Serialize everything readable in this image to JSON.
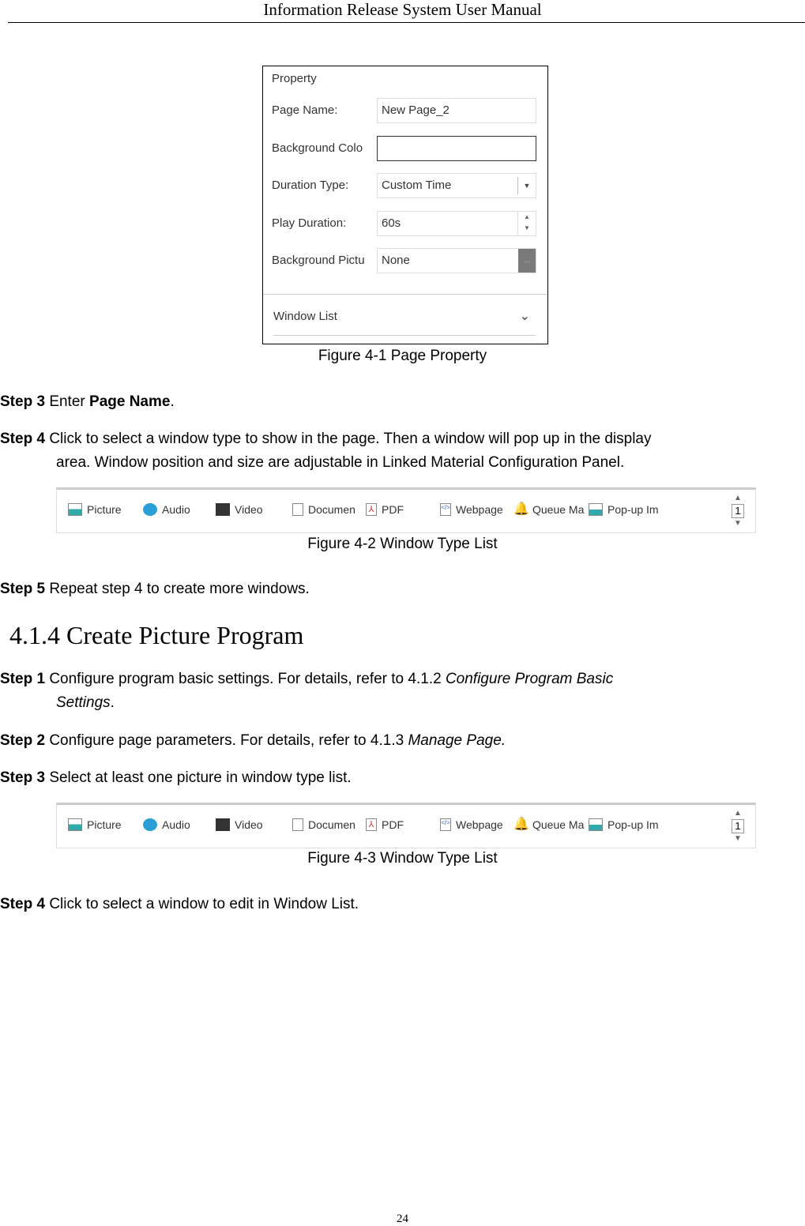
{
  "header": {
    "title": "Information Release System User Manual"
  },
  "figure1": {
    "panel_title": "Property",
    "fields": [
      {
        "label": "Page Name:",
        "value": "New Page_2"
      },
      {
        "label": "Background Colo",
        "value": ""
      },
      {
        "label": "Duration Type:",
        "value": "Custom Time"
      },
      {
        "label": "Play Duration:",
        "value": "60s"
      },
      {
        "label": "Background Pictu",
        "value": "None"
      }
    ],
    "browse_label": "...",
    "window_list_label": "Window List",
    "caption": "Figure 4-1 Page Property"
  },
  "steps_a": [
    {
      "num": "Step 3",
      "pre": "Enter ",
      "bold": "Page Name",
      "post": "."
    },
    {
      "num": "Step 4",
      "text": "Click to select a window type to show in the page. Then a window will pop up in the display",
      "cont": "area. Window position and size are adjustable in Linked Material Configuration Panel."
    }
  ],
  "window_types": [
    "Picture",
    "Audio",
    "Video",
    "Documen",
    "PDF",
    "Webpage",
    "Queue Ma",
    "Pop-up Im"
  ],
  "pager": {
    "up": "▲",
    "page": "1",
    "down": "▼"
  },
  "figure2": {
    "caption": "Figure 4-2 Window Type List"
  },
  "step5": {
    "num": "Step 5",
    "text": "Repeat step 4 to create more windows."
  },
  "section": {
    "title": "4.1.4 Create Picture Program"
  },
  "steps_b": [
    {
      "num": "Step 1",
      "text": "Configure program basic settings. For details, refer to 4.1.2 ",
      "ital": "Configure Program Basic",
      "cont_ital": "Settings",
      "cont": "."
    },
    {
      "num": "Step 2",
      "text": "Configure page parameters. For details, refer to 4.1.3 ",
      "ital": "Manage Page."
    },
    {
      "num": "Step 3",
      "text": "Select at least one picture in window type list."
    }
  ],
  "figure3": {
    "caption": "Figure 4-3 Window Type List"
  },
  "step_last": {
    "num": "Step 4",
    "text": "Click to select a window to edit in Window List."
  },
  "page_number": "24"
}
